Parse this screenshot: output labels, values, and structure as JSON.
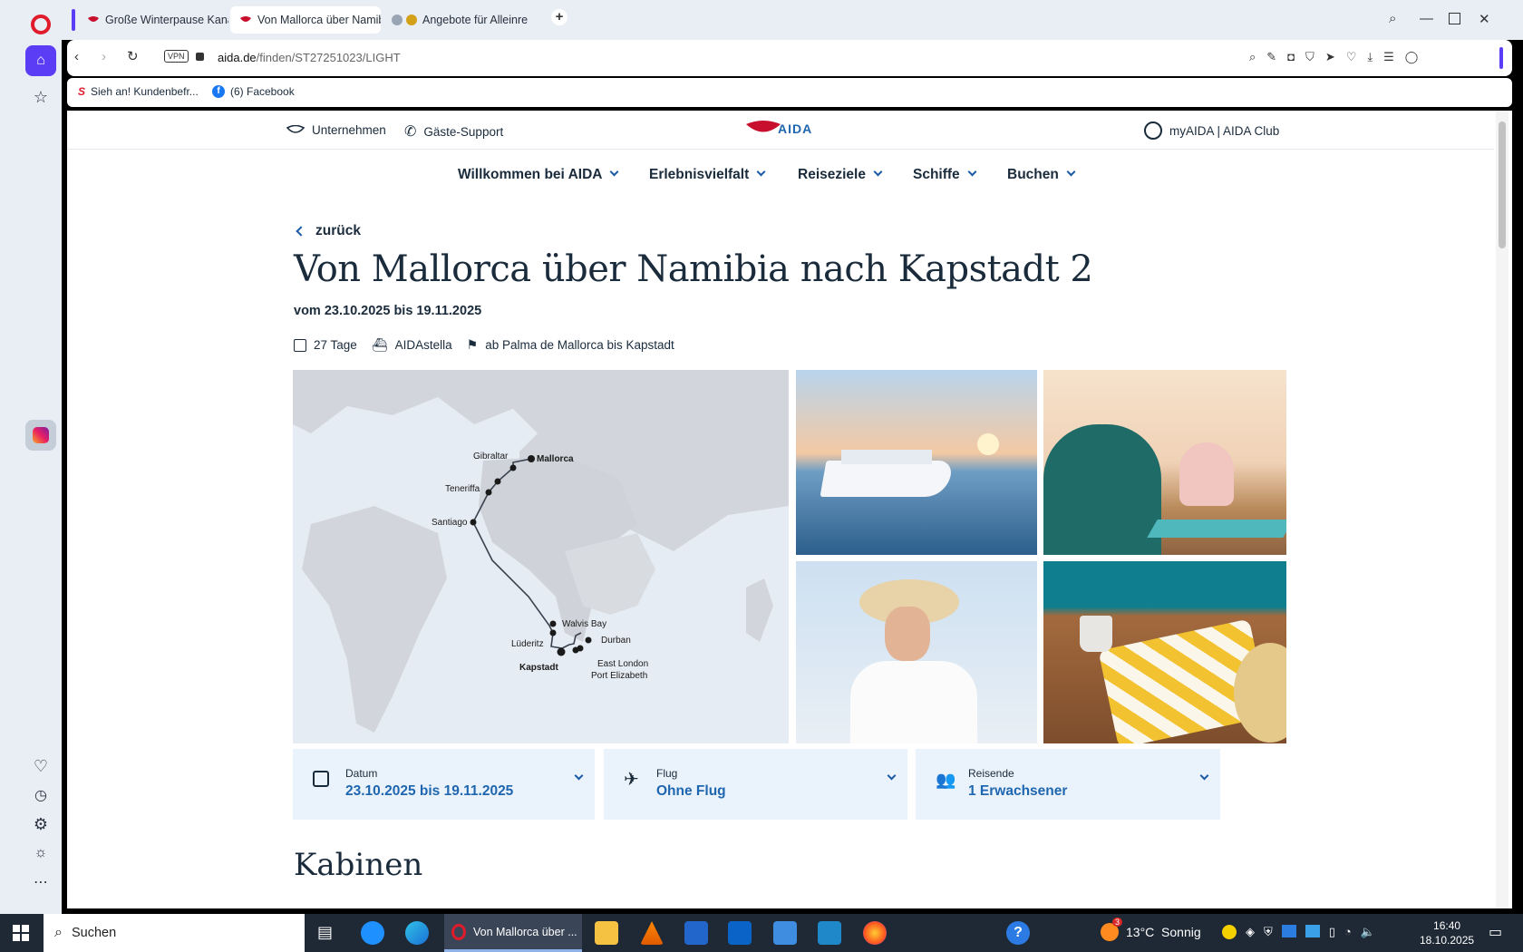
{
  "browser": {
    "tabs": [
      {
        "title": "Große Winterpause Kanar"
      },
      {
        "title": "Von Mallorca über Namib"
      },
      {
        "title": "Angebote für Alleinreis"
      }
    ],
    "url_domain": "aida.de",
    "url_path": "/finden/ST27251023/LIGHT",
    "vpn_label": "VPN",
    "bookmarks": [
      {
        "label": "Sieh an! Kundenbefr..."
      },
      {
        "label": "(6) Facebook"
      }
    ]
  },
  "site": {
    "topbar": {
      "company": "Unternehmen",
      "support": "Gäste-Support",
      "logo_text": "AIDA",
      "account": "myAIDA | AIDA Club"
    },
    "nav": [
      {
        "label": "Willkommen bei AIDA"
      },
      {
        "label": "Erlebnisvielfalt"
      },
      {
        "label": "Reiseziele"
      },
      {
        "label": "Schiffe"
      },
      {
        "label": "Buchen"
      }
    ],
    "back_label": "zurück",
    "title": "Von Mallorca über Namibia nach Kapstadt 2",
    "date_range": "vom 23.10.2025 bis 19.11.2025",
    "meta": {
      "duration": "27 Tage",
      "ship": "AIDAstella",
      "route": "ab Palma de Mallorca bis Kapstadt"
    },
    "map_labels": {
      "mallorca": "Mallorca",
      "gibraltar": "Gibraltar",
      "teneriffa": "Teneriffa",
      "santiago": "Santiago",
      "walvis": "Walvis Bay",
      "luederitz": "Lüderitz",
      "kapstadt": "Kapstadt",
      "durban": "Durban",
      "eastlondon": "East London",
      "portelizabeth": "Port Elizabeth"
    },
    "filters": [
      {
        "label": "Datum",
        "value": "23.10.2025 bis 19.11.2025"
      },
      {
        "label": "Flug",
        "value": "Ohne Flug"
      },
      {
        "label": "Reisende",
        "value": "1 Erwachsener"
      }
    ],
    "section_title": "Kabinen"
  },
  "taskbar": {
    "search": "Suchen",
    "active_app": "Von Mallorca über ...",
    "weather": "13°C  Sonnig",
    "weather_badge": "3",
    "time": "16:40",
    "date": "18.10.2025"
  },
  "colors": {
    "accent": "#1f66b0",
    "brand_red": "#c8102e",
    "card_bg": "#eaf3fb"
  }
}
